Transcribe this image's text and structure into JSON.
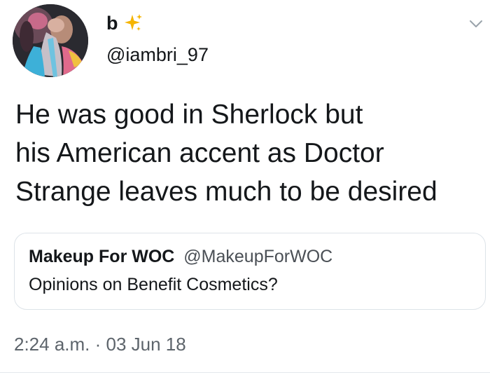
{
  "tweet": {
    "author": {
      "display_name": "b",
      "handle": "@iambri_97"
    },
    "text_lines": [
      "He was good in Sherlock but",
      "his American accent as Doctor",
      "Strange leaves much to be desired"
    ],
    "quoted_tweet": {
      "author_name": "Makeup For WOC",
      "author_handle": "@MakeupForWOC",
      "text": "Opinions on Benefit Cosmetics?"
    },
    "timestamp": "2:24 a.m. · 03 Jun 18"
  },
  "icons": {
    "name_emoji": "sparkles-icon",
    "menu": "chevron-down-icon"
  },
  "colors": {
    "text": "#14171a",
    "secondary_text": "#5d646b",
    "border": "#dde3e8",
    "sparkle": "#f5b400"
  }
}
